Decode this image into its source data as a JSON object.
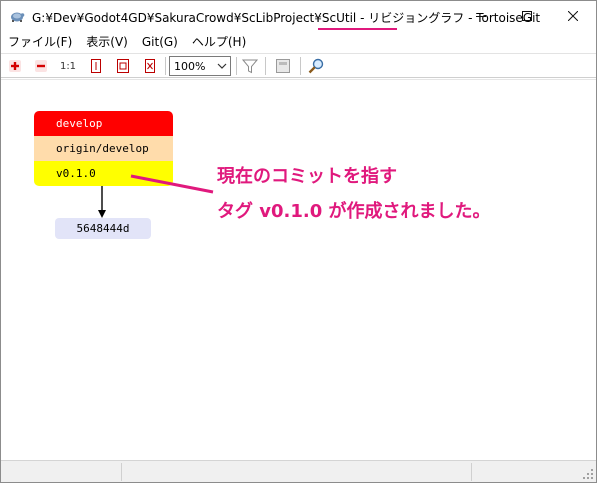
{
  "window": {
    "title_prefix": "G:¥Dev¥Godot4GD¥SakuraCrowd¥ScLibProject¥ScUtil - ",
    "title_highlight": "リビジョングラフ",
    "title_suffix": " - TortoiseGit",
    "accent": "#e0197d"
  },
  "menu": {
    "items": [
      "ファイル(F)",
      "表示(V)",
      "Git(G)",
      "ヘルプ(H)"
    ]
  },
  "toolbar": {
    "zoom_value": "100%",
    "icons": [
      "zoom-in-icon",
      "zoom-out-icon",
      "zoom-1to1-icon",
      "fit-height-icon",
      "fit-page-icon",
      "fit-width-icon",
      "filter-icon",
      "overview-icon",
      "search-icon"
    ],
    "zoom_1to1_label": "1:1"
  },
  "graph": {
    "refs": [
      {
        "label": "develop",
        "kind": "branch",
        "color": "#ff0000"
      },
      {
        "label": "origin/develop",
        "kind": "remote",
        "color": "#ffdcab"
      },
      {
        "label": "v0.1.0",
        "kind": "tag",
        "color": "#ffff00"
      }
    ],
    "commit": {
      "hash": "5648444d",
      "color": "#e2e4f8"
    }
  },
  "annotation": {
    "line1": "現在のコミットを指す",
    "line2": "タグ v0.1.0 が作成されました。"
  }
}
